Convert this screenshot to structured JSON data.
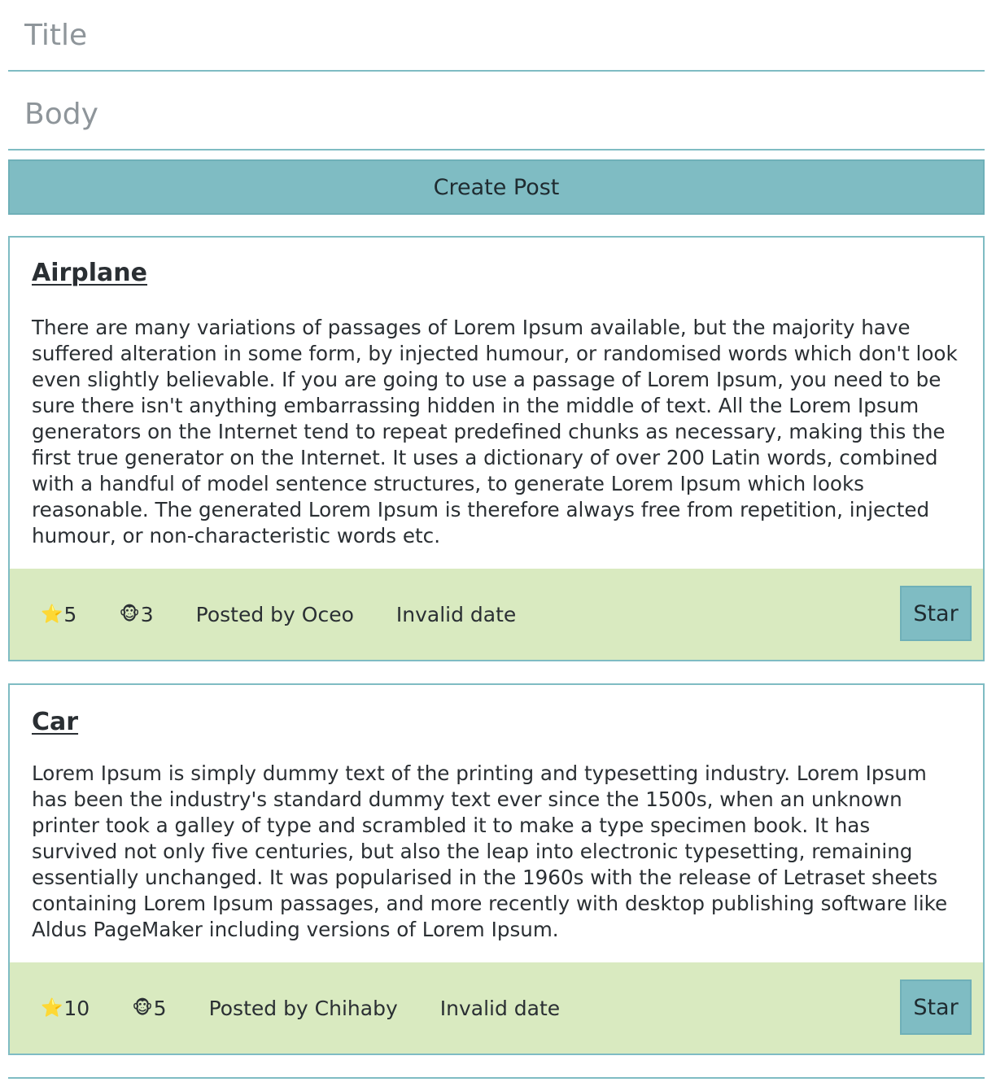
{
  "form": {
    "title_placeholder": "Title",
    "body_placeholder": "Body",
    "create_label": "Create Post"
  },
  "icons": {
    "star": "⭐",
    "monkey": "🐵"
  },
  "colors": {
    "accent": "#7fbcc3",
    "footer_bg": "#d9eac0",
    "text": "#2a2f33"
  },
  "posts": [
    {
      "title": "Airplane",
      "body": "There are many variations of passages of Lorem Ipsum available, but the majority have suffered alteration in some form, by injected humour, or randomised words which don't look even slightly believable. If you are going to use a passage of Lorem Ipsum, you need to be sure there isn't anything embarrassing hidden in the middle of text. All the Lorem Ipsum generators on the Internet tend to repeat predefined chunks as necessary, making this the first true generator on the Internet. It uses a dictionary of over 200 Latin words, combined with a handful of model sentence structures, to generate Lorem Ipsum which looks reasonable. The generated Lorem Ipsum is therefore always free from repetition, injected humour, or non-characteristic words etc.",
      "stars": "5",
      "monkeys": "3",
      "posted_by": "Posted by Oceo",
      "date": "Invalid date",
      "star_label": "Star"
    },
    {
      "title": "Car",
      "body": "Lorem Ipsum is simply dummy text of the printing and typesetting industry. Lorem Ipsum has been the industry's standard dummy text ever since the 1500s, when an unknown printer took a galley of type and scrambled it to make a type specimen book. It has survived not only five centuries, but also the leap into electronic typesetting, remaining essentially unchanged. It was popularised in the 1960s with the release of Letraset sheets containing Lorem Ipsum passages, and more recently with desktop publishing software like Aldus PageMaker including versions of Lorem Ipsum.",
      "stars": "10",
      "monkeys": "5",
      "posted_by": "Posted by Chihaby",
      "date": "Invalid date",
      "star_label": "Star"
    }
  ]
}
